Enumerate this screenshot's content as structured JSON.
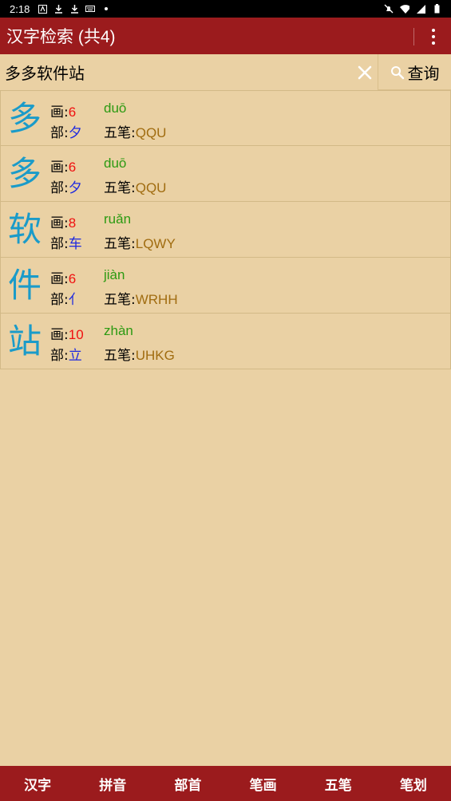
{
  "status": {
    "time": "2:18"
  },
  "appbar": {
    "title": "汉字检索 (共4)"
  },
  "search": {
    "value": "多多软件站",
    "query_label": "查询"
  },
  "labels": {
    "strokes": "画:",
    "radical": "部:",
    "wubi": "五笔:"
  },
  "results": [
    {
      "char": "多",
      "strokes": "6",
      "pinyin": "duō",
      "radical": "夕",
      "wubi": "QQU"
    },
    {
      "char": "多",
      "strokes": "6",
      "pinyin": "duō",
      "radical": "夕",
      "wubi": "QQU"
    },
    {
      "char": "软",
      "strokes": "8",
      "pinyin": "ruǎn",
      "radical": "车",
      "wubi": "LQWY"
    },
    {
      "char": "件",
      "strokes": "6",
      "pinyin": "jiàn",
      "radical": "亻",
      "wubi": "WRHH"
    },
    {
      "char": "站",
      "strokes": "10",
      "pinyin": "zhàn",
      "radical": "立",
      "wubi": "UHKG"
    }
  ],
  "bottom_tabs": [
    "汉字",
    "拼音",
    "部首",
    "笔画",
    "五笔",
    "笔划"
  ],
  "colors": {
    "appbar": "#9b1b1d",
    "background": "#ead1a4",
    "char": "#1a9bc9",
    "strokes": "#f01010",
    "pinyin": "#2c9a12",
    "radical": "#1c28e0",
    "wubi": "#a06c10"
  }
}
